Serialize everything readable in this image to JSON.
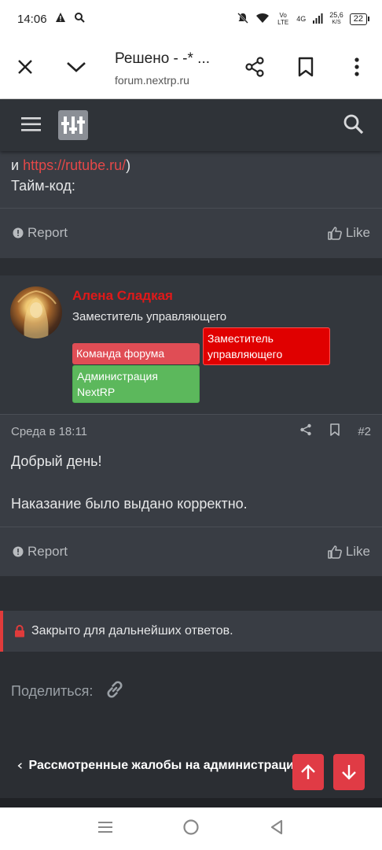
{
  "status_bar": {
    "time": "14:06",
    "net_speed": "25,6",
    "net_unit": "K/S",
    "network_type": "4G",
    "lte_label": "Vo LTE",
    "battery": "22"
  },
  "browser": {
    "page_title": "Решено - -* ...",
    "domain": "forum.nextrp.ru"
  },
  "post1": {
    "link_prefix": "и ",
    "link_text": "https://rutube.ru/",
    "link_suffix": ")",
    "timecode_label": "Тайм-код:",
    "report_label": "Report",
    "like_label": "Like"
  },
  "post2": {
    "username": "Алена Сладкая",
    "user_title": "Заместитель управляющего",
    "badges": {
      "deputy": "Заместитель управляющего",
      "team": "Команда форума",
      "admin": "Администрация NextRP"
    },
    "date": "Среда в 18:11",
    "post_number": "#2",
    "greeting": "Добрый день!",
    "body": "Наказание было выдано корректно.",
    "report_label": "Report",
    "like_label": "Like"
  },
  "thread": {
    "locked_message": "Закрыто для дальнейших ответов.",
    "share_label": "Поделиться:",
    "back_link": "Рассмотренные жалобы на администраци"
  },
  "colors": {
    "accent": "#e03b45",
    "username": "#e01919",
    "link": "#e54848",
    "badge_admin": "#5cb85c"
  }
}
